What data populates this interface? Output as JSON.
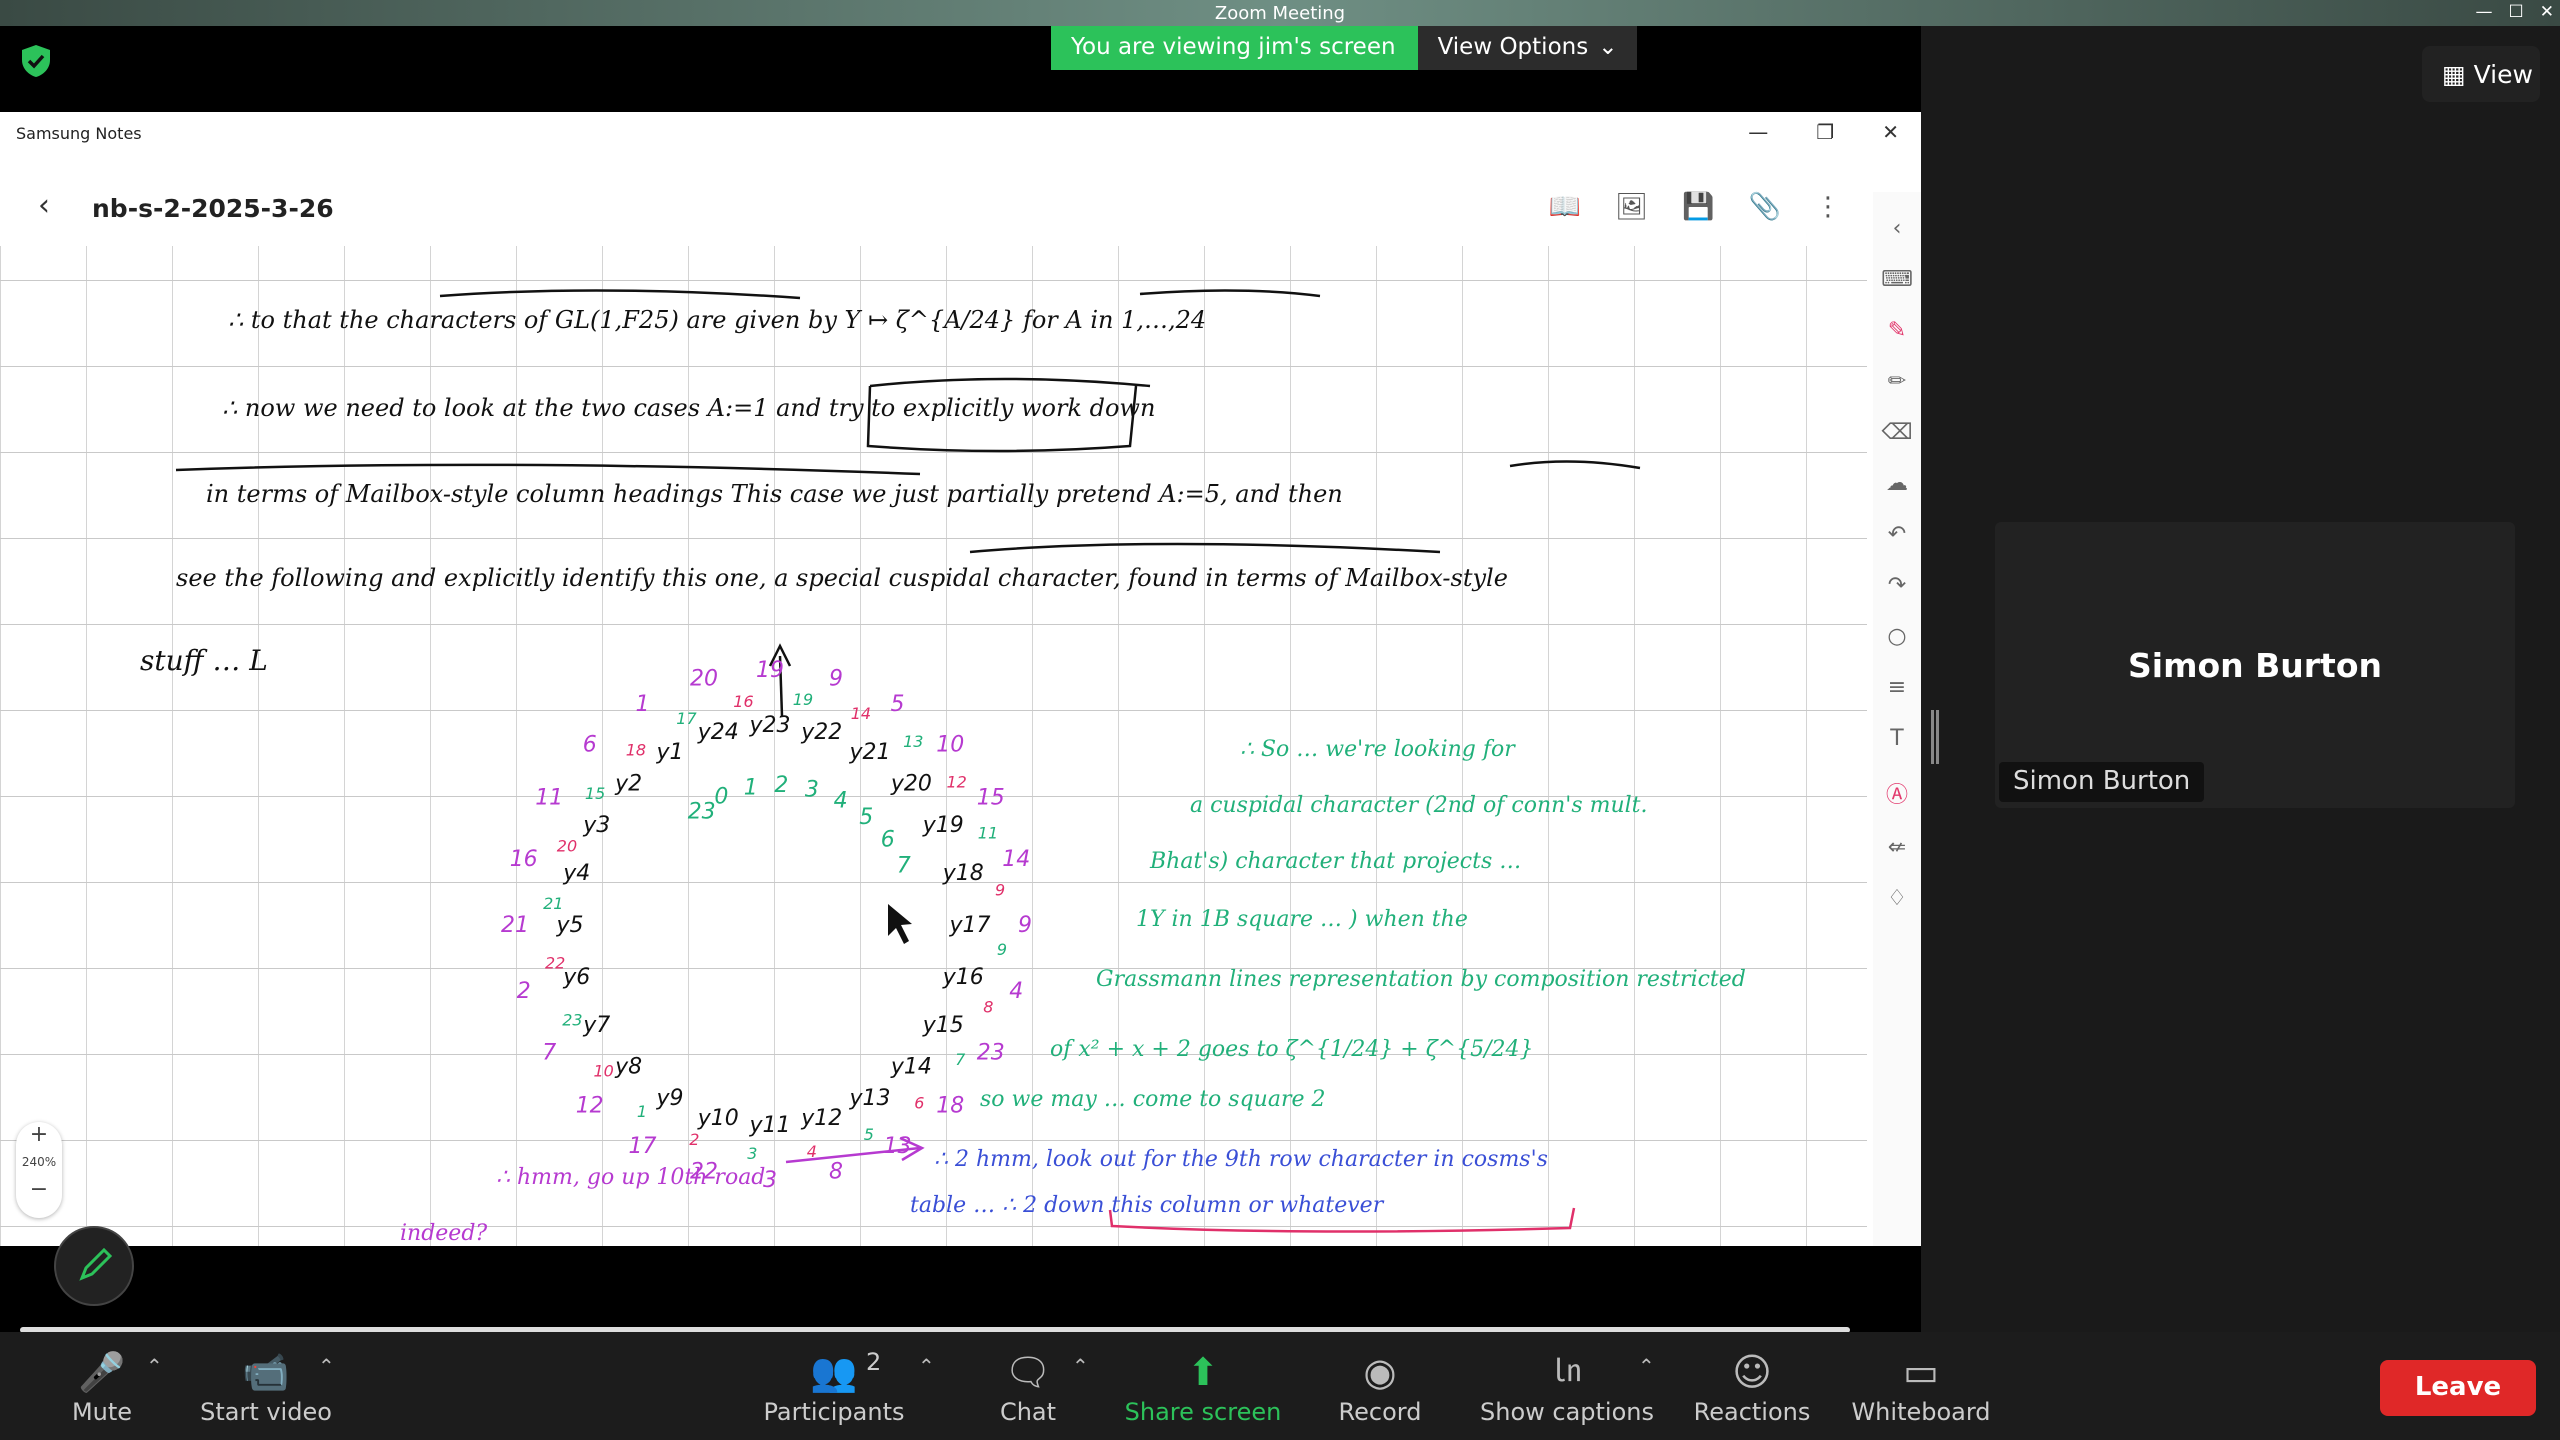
{
  "window": {
    "title": "Zoom Meeting"
  },
  "share_banner": {
    "text": "You are viewing jim's screen",
    "view_options": "View Options"
  },
  "notes_app": {
    "window_title": "Samsung Notes",
    "doc_title": "nb-s-2-2025-3-26",
    "zoom_level": "240%"
  },
  "handwriting": {
    "black_lines": [
      "∴ to that the characters of GL(1,F25) are given by Y ↦ ζ^{A/24} for A in 1,…,24",
      "∴ now we need to look at the two cases A:=1 and try to explicitly work down",
      "in terms of Mailbox-style column headings  This case we just partially pretend A:=5, and then",
      "see the following and explicitly identify this one, a special cuspidal character, found in terms of Mailbox-style",
      "stuff … L"
    ],
    "green_notes": [
      "∴ So … we're looking for",
      "a cuspidal character (2nd of conn's mult.",
      "Bhat's) character that projects …",
      "1Y in 1B square … ) when the",
      "Grassmann lines representation by composition restricted",
      "of x² + x + 2 goes to ζ^{1/24} + ζ^{5/24}",
      "so we may … come to square 2"
    ],
    "blue_notes": [
      "∴ 2 hmm, look out for the 9th row character in cosms's",
      "table … ∴ 2 down this column or whatever"
    ],
    "purple_notes": [
      "∴ hmm, go up 10th road",
      "indeed?"
    ],
    "circle_outer": [
      "19",
      "9",
      "5",
      "10",
      "15",
      "14",
      "9",
      "4",
      "23",
      "18",
      "13",
      "8",
      "3",
      "22",
      "17",
      "12",
      "7",
      "2",
      "21",
      "16",
      "11",
      "6",
      "1",
      "20"
    ],
    "circle_mid": [
      "y23",
      "y22",
      "y21",
      "y20",
      "y19",
      "y18",
      "y17",
      "y16",
      "y15",
      "y14",
      "y13",
      "y12",
      "y11",
      "y10",
      "y9",
      "y8",
      "y7",
      "y6",
      "y5",
      "y4",
      "y3",
      "y2",
      "y1",
      "y24"
    ],
    "circle_inner": [
      "23",
      "0",
      "1",
      "2",
      "3",
      "4",
      "5",
      "6",
      "7"
    ]
  },
  "participant": {
    "name": "Simon Burton",
    "label": "Simon Burton"
  },
  "view_button": "View",
  "toolbar": {
    "mute": "Mute",
    "start_video": "Start video",
    "participants": "Participants",
    "participants_count": "2",
    "chat": "Chat",
    "share_screen": "Share screen",
    "record": "Record",
    "show_captions": "Show captions",
    "reactions": "Reactions",
    "whiteboard": "Whiteboard",
    "leave": "Leave"
  },
  "colors": {
    "share_green": "#2cc25a",
    "leave_red": "#e02828",
    "ink_black": "#111111",
    "ink_green": "#21b07a",
    "ink_blue": "#3a4fd6",
    "ink_purple": "#b63ad0",
    "ink_pink": "#e0306a"
  }
}
